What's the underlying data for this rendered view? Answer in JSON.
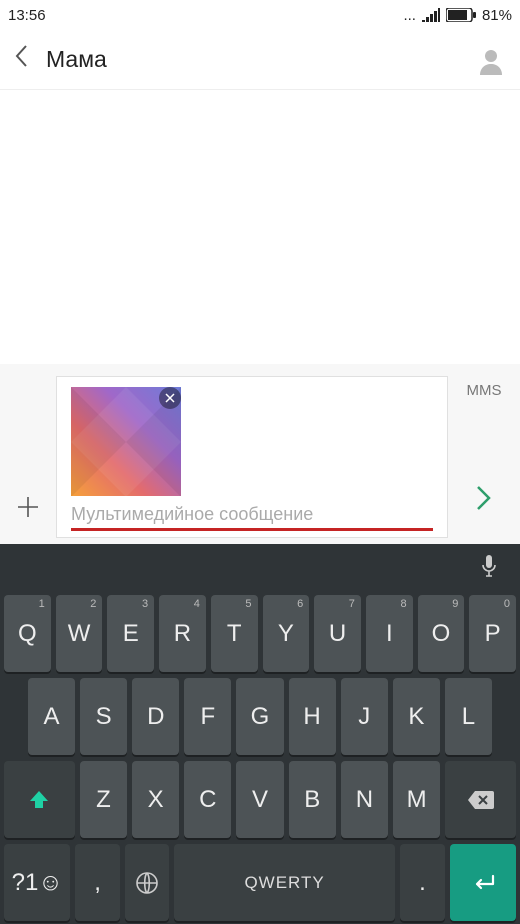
{
  "status": {
    "time": "13:56",
    "dots": "...",
    "battery_pct": "81%"
  },
  "header": {
    "title": "Мама"
  },
  "compose": {
    "placeholder": "Мультимедийное сообщение",
    "mode": "MMS"
  },
  "keyboard": {
    "row1": [
      {
        "l": "Q",
        "s": "1"
      },
      {
        "l": "W",
        "s": "2"
      },
      {
        "l": "E",
        "s": "3"
      },
      {
        "l": "R",
        "s": "4"
      },
      {
        "l": "T",
        "s": "5"
      },
      {
        "l": "Y",
        "s": "6"
      },
      {
        "l": "U",
        "s": "7"
      },
      {
        "l": "I",
        "s": "8"
      },
      {
        "l": "O",
        "s": "9"
      },
      {
        "l": "P",
        "s": "0"
      }
    ],
    "row2": [
      "A",
      "S",
      "D",
      "F",
      "G",
      "H",
      "J",
      "K",
      "L"
    ],
    "row3": [
      "Z",
      "X",
      "C",
      "V",
      "B",
      "N",
      "M"
    ],
    "sym_key": "?1☺",
    "comma_key": ",",
    "space_label": "QWERTY",
    "period_key": "."
  }
}
